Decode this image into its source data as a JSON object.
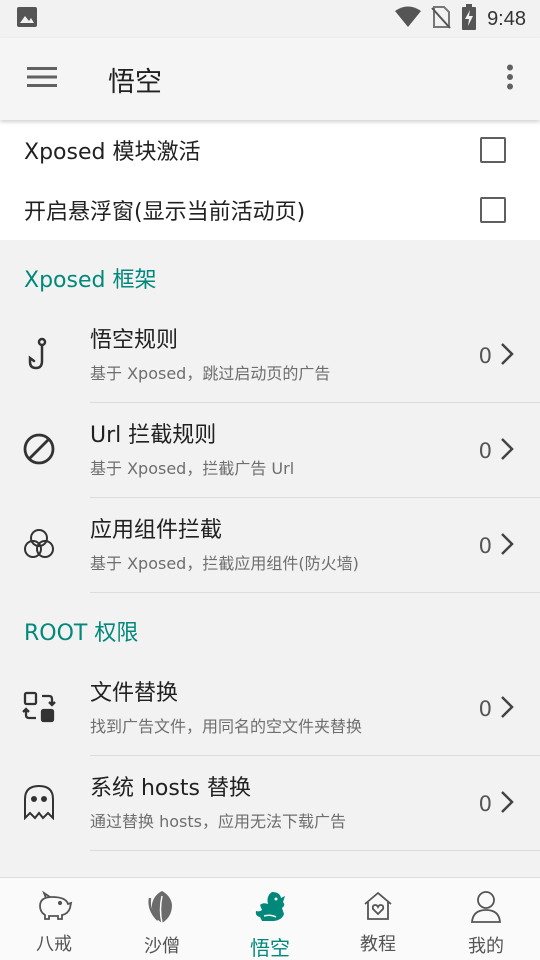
{
  "status_bar": {
    "time": "9:48"
  },
  "app_bar": {
    "title": "悟空"
  },
  "toggles": [
    {
      "label": "Xposed 模块激活",
      "checked": false
    },
    {
      "label": "开启悬浮窗(显示当前活动页)",
      "checked": false
    }
  ],
  "sections": [
    {
      "header": "Xposed 框架",
      "items": [
        {
          "icon": "hook-icon",
          "title": "悟空规则",
          "subtitle": "基于 Xposed，跳过启动页的广告",
          "count": "0"
        },
        {
          "icon": "block-icon",
          "title": "Url 拦截规则",
          "subtitle": "基于 Xposed，拦截广告 Url",
          "count": "0"
        },
        {
          "icon": "components-icon",
          "title": "应用组件拦截",
          "subtitle": "基于 Xposed，拦截应用组件(防火墙)",
          "count": "0"
        }
      ]
    },
    {
      "header": "ROOT 权限",
      "items": [
        {
          "icon": "file-replace-icon",
          "title": "文件替换",
          "subtitle": "找到广告文件，用同名的空文件夹替换",
          "count": "0"
        },
        {
          "icon": "ghost-icon",
          "title": "系统 hosts 替换",
          "subtitle": "通过替换 hosts，应用无法下载广告",
          "count": "0"
        }
      ]
    }
  ],
  "bottom_nav": [
    {
      "label": "八戒",
      "icon": "pig-icon",
      "active": false
    },
    {
      "label": "沙僧",
      "icon": "leaf-icon",
      "active": false
    },
    {
      "label": "悟空",
      "icon": "monkey-icon",
      "active": true
    },
    {
      "label": "教程",
      "icon": "home-heart-icon",
      "active": false
    },
    {
      "label": "我的",
      "icon": "person-icon",
      "active": false
    }
  ],
  "colors": {
    "accent": "#00897b",
    "background": "#f2f2f2",
    "card": "#ffffff"
  }
}
